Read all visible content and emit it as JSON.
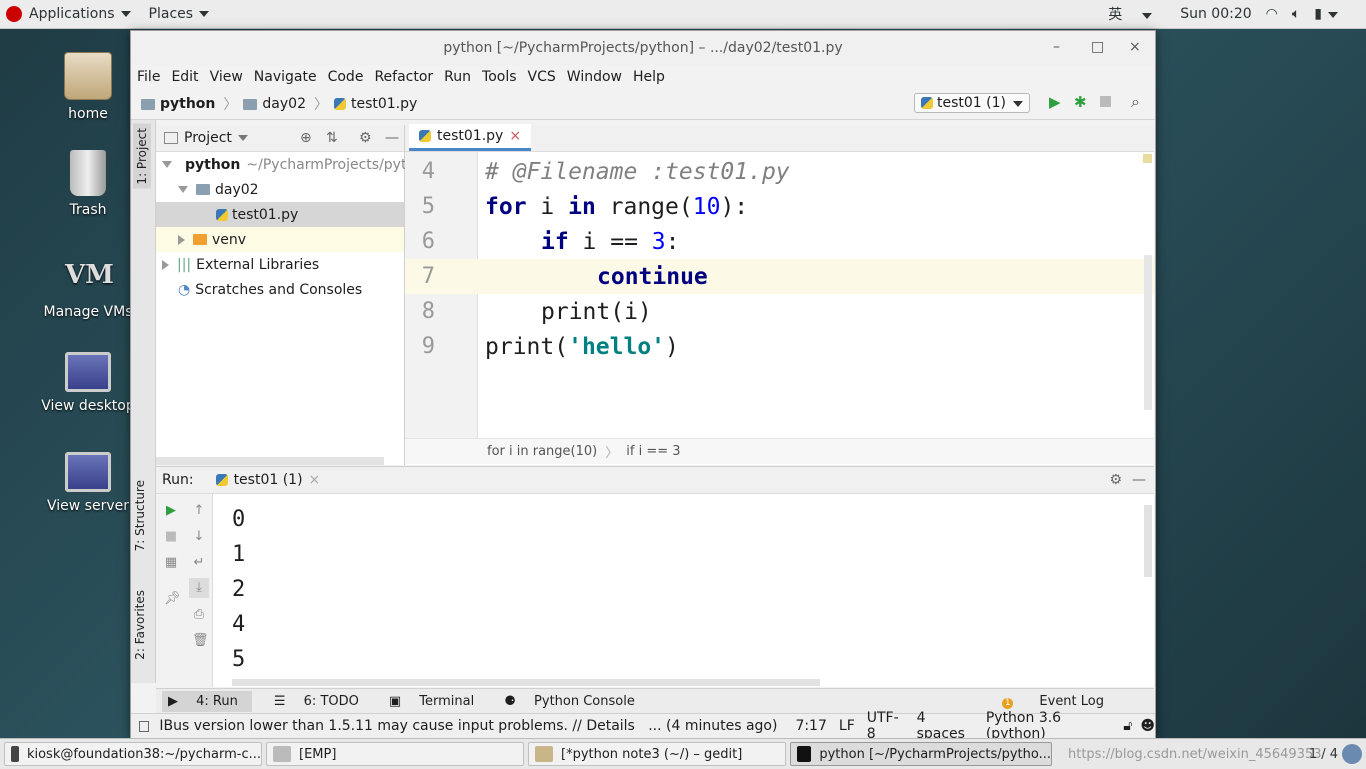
{
  "topbar": {
    "applications": "Applications",
    "places": "Places",
    "ime": "英",
    "clock": "Sun 00:20"
  },
  "desktop": {
    "icons": [
      {
        "label": "home"
      },
      {
        "label": "Trash"
      },
      {
        "label": "Manage VMs"
      },
      {
        "label": "View desktop"
      },
      {
        "label": "View server"
      }
    ]
  },
  "window": {
    "title": "python [~/PycharmProjects/python] – .../day02/test01.py",
    "minimize": "–",
    "maximize": "□",
    "close": "×"
  },
  "menu": [
    "File",
    "Edit",
    "View",
    "Navigate",
    "Code",
    "Refactor",
    "Run",
    "Tools",
    "VCS",
    "Window",
    "Help"
  ],
  "nav": {
    "crumbs": [
      "python",
      "day02",
      "test01.py"
    ],
    "run_config": "test01 (1)"
  },
  "sidebar_tabs": {
    "project": "1: Project",
    "structure": "7: Structure",
    "favorites": "2: Favorites"
  },
  "project": {
    "header": "Project",
    "root": "python",
    "root_path": "~/PycharmProjects/pyth",
    "folder": "day02",
    "file": "test01.py",
    "venv": "venv",
    "ext_libs": "External Libraries",
    "scratches": "Scratches and Consoles"
  },
  "editor": {
    "tab": "test01.py",
    "lines": [
      {
        "n": "4",
        "comment": "# @Filename    :test01.py"
      },
      {
        "n": "5",
        "kw": "for",
        "a": " i ",
        "kw2": "in",
        "b": " range(",
        "num": "10",
        "c": "):"
      },
      {
        "n": "6",
        "kw": "if",
        "a": " i == ",
        "num": "3",
        "c": ":"
      },
      {
        "n": "7",
        "kw": "continue"
      },
      {
        "n": "8",
        "a": "print(i)"
      },
      {
        "n": "9",
        "a": "print(",
        "str": "'hello'",
        "c": ")"
      }
    ],
    "breadcrumb": [
      "for i in range(10)",
      "if i == 3"
    ]
  },
  "run": {
    "label": "Run:",
    "tab": "test01 (1)",
    "output": [
      "0",
      "1",
      "2",
      "4",
      "5"
    ]
  },
  "tool_tabs": [
    "4: Run",
    "6: TODO",
    "Terminal",
    "Python Console"
  ],
  "event_log": "Event Log",
  "status": {
    "message": "IBus version lower than 1.5.11 may cause input problems. // Details   ... (4 minutes ago)",
    "position": "7:17",
    "line_sep": "LF",
    "encoding": "UTF-8",
    "indent": "4 spaces",
    "interpreter": "Python 3.6 (python)"
  },
  "taskbar": {
    "items": [
      "kiosk@foundation38:~/pycharm-c...",
      "[EMP]",
      "[*python note3 (~/) – gedit]",
      "python [~/PycharmProjects/pytho..."
    ],
    "pager": "1 / 4",
    "watermark": "https://blog.csdn.net/weixin_45649353"
  }
}
